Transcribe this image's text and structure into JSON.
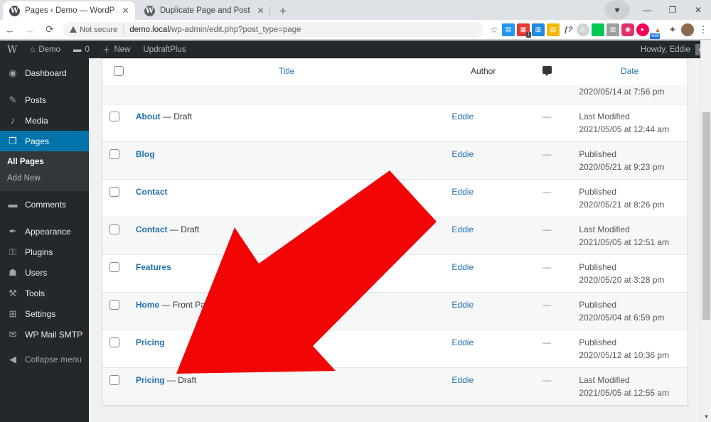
{
  "browser": {
    "tabs": [
      {
        "title": "Pages ‹ Demo — WordPress",
        "favicon": "wordpress-icon",
        "close": "✕",
        "active": true
      },
      {
        "title": "Duplicate Page and Post – WordP",
        "favicon": "wordpress-icon",
        "close": "✕",
        "active": false
      }
    ],
    "new_tab_label": "+",
    "window_controls": {
      "minimize": "—",
      "maximize": "❐",
      "close": "✕",
      "profile": "●"
    },
    "nav": {
      "back": "←",
      "forward": "→",
      "reload": "⟳"
    },
    "omnibox": {
      "security_label": "Not secure",
      "url_host": "demo.local",
      "url_path": "/wp-admin/edit.php?post_type=page",
      "bookmark_star": "☆"
    },
    "extensions": [
      {
        "name": "screenshot-extension",
        "glyph": "▤",
        "color": "#2196f3"
      },
      {
        "name": "adblock-extension",
        "glyph": "▦",
        "color": "#e53935",
        "badge": "1"
      },
      {
        "name": "translate-extension",
        "glyph": "▥",
        "color": "#1e88e5"
      },
      {
        "name": "notes-extension",
        "glyph": "▤",
        "color": "#f5b800"
      },
      {
        "name": "fontface-extension",
        "glyph": "ƒ?",
        "color": "#1a1a1a"
      },
      {
        "name": "kamelio-extension",
        "glyph": "K",
        "color": "#bdbdbd"
      },
      {
        "name": "green-extension",
        "glyph": "",
        "color": "#00c853"
      },
      {
        "name": "film-extension",
        "glyph": "▥",
        "color": "#9e9e9e"
      },
      {
        "name": "instagram-extension",
        "glyph": "◉",
        "color": "#e1306c"
      },
      {
        "name": "record-extension",
        "glyph": "▶",
        "color": "#f50057"
      },
      {
        "name": "redirector-extension",
        "glyph": "▲",
        "color": "#c77a2e",
        "tag": "redir"
      },
      {
        "name": "puzzle-extensions-icon",
        "glyph": "✦",
        "color": "#5f6368"
      },
      {
        "name": "chrome-profile-avatar",
        "glyph": "",
        "color": "#8a6a4a"
      }
    ],
    "menu_kebab": "⋮"
  },
  "adminbar": {
    "logo": "W",
    "site_name": "Demo",
    "comments_count": "0",
    "new_label": "New",
    "plugin_label": "UpdraftPlus",
    "howdy": "Howdy, Eddie"
  },
  "sidebar": {
    "items": [
      {
        "label": "Dashboard",
        "icon": "dashboard-icon",
        "glyph": "◉",
        "current": false
      },
      {
        "label": "Posts",
        "icon": "pin-icon",
        "glyph": "✎",
        "current": false,
        "spaced": true
      },
      {
        "label": "Media",
        "icon": "media-icon",
        "glyph": "♪",
        "current": false
      },
      {
        "label": "Pages",
        "icon": "pages-icon",
        "glyph": "❐",
        "current": true
      },
      {
        "label": "Comments",
        "icon": "comments-icon",
        "glyph": "▬",
        "current": false,
        "spaced": true
      },
      {
        "label": "Appearance",
        "icon": "appearance-icon",
        "glyph": "✒",
        "current": false,
        "spaced": true
      },
      {
        "label": "Plugins",
        "icon": "plugins-icon",
        "glyph": "⚿",
        "current": false
      },
      {
        "label": "Users",
        "icon": "users-icon",
        "glyph": "☗",
        "current": false
      },
      {
        "label": "Tools",
        "icon": "tools-icon",
        "glyph": "⚒",
        "current": false
      },
      {
        "label": "Settings",
        "icon": "settings-icon",
        "glyph": "⊞",
        "current": false
      },
      {
        "label": "WP Mail SMTP",
        "icon": "mail-icon",
        "glyph": "✉",
        "current": false
      }
    ],
    "submenu": [
      {
        "label": "All Pages",
        "current": true
      },
      {
        "label": "Add New",
        "current": false
      }
    ],
    "collapse": {
      "label": "Collapse menu",
      "icon": "collapse-icon",
      "glyph": "◀"
    }
  },
  "table": {
    "columns": [
      {
        "key": "cb",
        "label": ""
      },
      {
        "key": "title",
        "label": "Title"
      },
      {
        "key": "author",
        "label": "Author"
      },
      {
        "key": "comments",
        "label": "comments-bubble-icon"
      },
      {
        "key": "date",
        "label": "Date"
      }
    ],
    "partial_top_row": {
      "date_stamp": "2020/05/14 at 7:56 pm"
    },
    "rows": [
      {
        "title": "About",
        "state": "— Draft",
        "author": "Eddie",
        "comments": "—",
        "date_status": "Last Modified",
        "date_stamp": "2021/05/05 at 12:44 am",
        "alt": false
      },
      {
        "title": "Blog",
        "state": "",
        "author": "Eddie",
        "comments": "—",
        "date_status": "Published",
        "date_stamp": "2020/05/21 at 9:23 pm",
        "alt": true
      },
      {
        "title": "Contact",
        "state": "",
        "author": "Eddie",
        "comments": "—",
        "date_status": "Published",
        "date_stamp": "2020/05/21 at 8:26 pm",
        "alt": false
      },
      {
        "title": "Contact",
        "state": "— Draft",
        "author": "Eddie",
        "comments": "—",
        "date_status": "Last Modified",
        "date_stamp": "2021/05/05 at 12:51 am",
        "alt": true
      },
      {
        "title": "Features",
        "state": "",
        "author": "Eddie",
        "comments": "—",
        "date_status": "Published",
        "date_stamp": "2020/05/20 at 3:28 pm",
        "alt": false
      },
      {
        "title": "Home",
        "state": "— Front Page",
        "author": "Eddie",
        "comments": "—",
        "date_status": "Published",
        "date_stamp": "2020/05/04 at 6:59 pm",
        "alt": true
      },
      {
        "title": "Pricing",
        "state": "",
        "author": "Eddie",
        "comments": "—",
        "date_status": "Published",
        "date_stamp": "2020/05/12 at 10:36 pm",
        "alt": false
      },
      {
        "title": "Pricing",
        "state": "— Draft",
        "author": "Eddie",
        "comments": "—",
        "date_status": "Last Modified",
        "date_stamp": "2021/05/05 at 12:55 am",
        "alt": true
      }
    ]
  },
  "annotation": {
    "arrow_color": "#f20505",
    "arrow_points": "548,240 614,312 440,487 472,522 248,526 330,320 364,371"
  },
  "scrollbar": {
    "down_arrow": "▼"
  },
  "colors": {
    "wp_admin_dark": "#23282d",
    "wp_blue": "#0073aa",
    "link_blue": "#2271b1",
    "arrow_red": "#f20505"
  }
}
